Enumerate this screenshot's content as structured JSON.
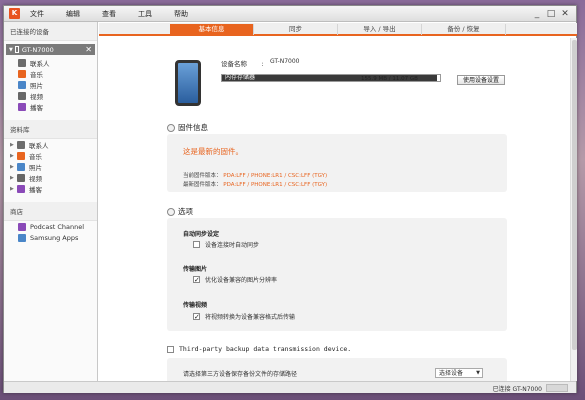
{
  "titlebar": {
    "logo": "K",
    "menu": [
      "文件",
      "编辑",
      "查看",
      "工具",
      "帮助"
    ],
    "controls": [
      "_",
      "□",
      "✕"
    ]
  },
  "sidebar": {
    "device_section": "已连接的设备",
    "device": {
      "name": "GT-N7000",
      "close": "✕"
    },
    "device_items": [
      {
        "label": "联系人",
        "icon": "contacts-icon",
        "color": "#6b6b6b"
      },
      {
        "label": "音乐",
        "icon": "music-icon",
        "color": "#e8641f"
      },
      {
        "label": "照片",
        "icon": "photo-icon",
        "color": "#4a86c8"
      },
      {
        "label": "视频",
        "icon": "video-icon",
        "color": "#666666"
      },
      {
        "label": "播客",
        "icon": "podcast-icon",
        "color": "#8a4ab8"
      }
    ],
    "library_section": "资料库",
    "library_items": [
      {
        "label": "联系人",
        "icon": "contacts-icon",
        "color": "#6b6b6b"
      },
      {
        "label": "音乐",
        "icon": "music-icon",
        "color": "#e8641f"
      },
      {
        "label": "照片",
        "icon": "photo-icon",
        "color": "#4a86c8"
      },
      {
        "label": "视频",
        "icon": "video-icon",
        "color": "#666666"
      },
      {
        "label": "播客",
        "icon": "podcast-icon",
        "color": "#8a4ab8"
      }
    ],
    "store_section": "商店",
    "store_items": [
      {
        "label": "Podcast Channel",
        "icon": "podcast-channel-icon",
        "color": "#8a4ab8"
      },
      {
        "label": "Samsung Apps",
        "icon": "samsung-apps-icon",
        "color": "#4a86c8"
      }
    ]
  },
  "tabs": [
    {
      "label": "基本信息",
      "active": true
    },
    {
      "label": "同步",
      "active": false
    },
    {
      "label": "导入 / 导出",
      "active": false
    },
    {
      "label": "备份 / 恢复",
      "active": false
    }
  ],
  "device_info": {
    "name_label": "设备名称",
    "name_sep": ":",
    "name_value": "GT-N7000",
    "storage_label": "内存存储器",
    "storage_value": "155.9 MB / 11.07 GB",
    "storage_fill_percent": 98.6,
    "reset_button": "使用设备设置",
    "accent": "#e8641f"
  },
  "firmware": {
    "header": "固件信息",
    "latest_msg": "这是最新的固件。",
    "current_label": "当前固件版本：",
    "current_value": "PDA:LFF / PHONE:LR1 / CSC:LFF (TGY)",
    "latest_label": "最新固件版本：",
    "latest_value": "PDA:LFF / PHONE:LR1 / CSC:LFF (TGY)"
  },
  "options": {
    "header": "选项",
    "groups": [
      {
        "title": "自动同步设定",
        "check_label": "设备连接时自动同步",
        "checked": false
      },
      {
        "title": "传输图片",
        "check_label": "优化设备兼容的图片分辨率",
        "checked": true
      },
      {
        "title": "传输视频",
        "check_label": "将视频转换为设备兼容格式后传输",
        "checked": true
      }
    ]
  },
  "third_party": {
    "label": "Third-party backup data transmission device.",
    "checked": false,
    "description": "请选择第三方设备保存备份文件的存储路径",
    "select_value": "选择设备",
    "dropdown": "▼"
  },
  "status": {
    "text": "已连接 GT-N7000"
  }
}
